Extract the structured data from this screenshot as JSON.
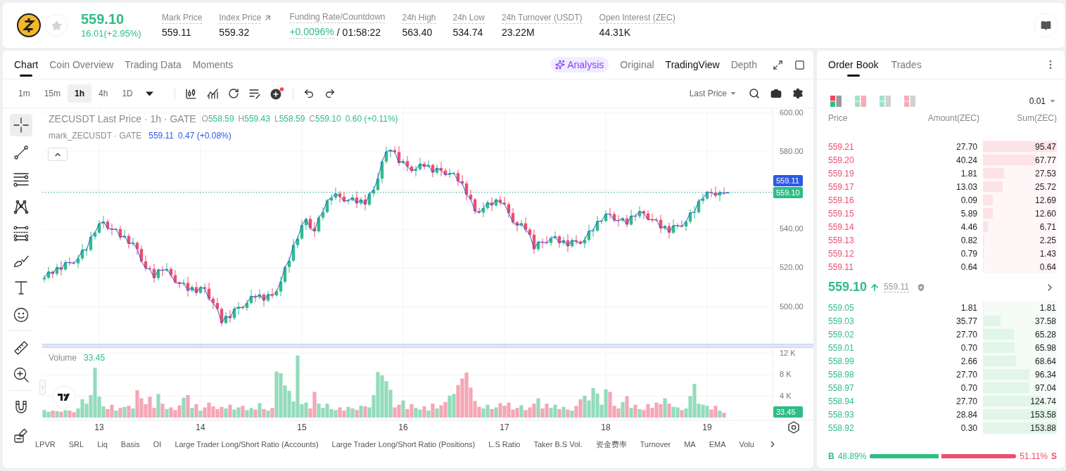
{
  "ticker": {
    "price": "559.10",
    "change": "16.01(+2.95%)",
    "stats": [
      {
        "kind": "plain",
        "label": "Mark Price",
        "value": "559.11"
      },
      {
        "kind": "link",
        "label": "Index Price",
        "value": "559.32"
      },
      {
        "kind": "funding",
        "label": "Funding Rate/Countdown",
        "value": "+0.0096%",
        "countdown": "/ 01:58:22"
      },
      {
        "kind": "plain",
        "label": "24h High",
        "value": "563.40"
      },
      {
        "kind": "plain",
        "label": "24h Low",
        "value": "534.74"
      },
      {
        "kind": "plain",
        "label": "24h Turnover (USDT)",
        "value": "23.22M"
      },
      {
        "kind": "plain",
        "label": "Open Interest (ZEC)",
        "value": "44.31K"
      }
    ]
  },
  "chart_panel": {
    "tabs": [
      {
        "label": "Chart",
        "selected": true
      },
      {
        "label": "Coin Overview",
        "selected": false
      },
      {
        "label": "Trading Data",
        "selected": false
      },
      {
        "label": "Moments",
        "selected": false
      }
    ],
    "ai_button": {
      "label": "Analysis"
    },
    "views": [
      {
        "label": "Original",
        "selected": false
      },
      {
        "label": "TradingView",
        "selected": true
      },
      {
        "label": "Depth",
        "selected": false
      }
    ],
    "intervals": [
      {
        "label": "1m",
        "selected": false
      },
      {
        "label": "15m",
        "selected": false
      },
      {
        "label": "1h",
        "selected": true
      },
      {
        "label": "4h",
        "selected": false
      },
      {
        "label": "1D",
        "selected": false
      }
    ],
    "price_source": "Last Price",
    "tool_groups": [
      [
        {
          "kind": "crosshair",
          "selected": true
        },
        {
          "kind": "trend_line",
          "selected": false
        },
        {
          "kind": "horizontal_lines",
          "selected": false
        },
        {
          "kind": "pattern",
          "selected": false
        },
        {
          "kind": "fib",
          "selected": false
        },
        {
          "kind": "brush",
          "selected": false
        },
        {
          "kind": "text",
          "selected": false
        },
        {
          "kind": "emoji",
          "selected": false
        }
      ],
      [
        {
          "kind": "ruler",
          "selected": false
        },
        {
          "kind": "zoom",
          "selected": false
        }
      ],
      [
        {
          "kind": "magnet",
          "selected": false
        },
        {
          "kind": "lock_drawing",
          "selected": false
        }
      ]
    ],
    "price_pane": {
      "legend": {
        "ohlc": [
          {
            "key": "O",
            "value": "558.59"
          },
          {
            "key": "H",
            "value": "559.43"
          },
          {
            "key": "L",
            "value": "558.59"
          },
          {
            "key": "C",
            "value": "559.10"
          }
        ],
        "change": "0.60 (+0.11%)",
        "mark_price": "559.11",
        "mark_change": "0.47 (+0.08%)"
      },
      "mark_badge": "559.11",
      "last_badge": "559.10",
      "chart_data": {
        "type": "candlestick",
        "title": "ZECUSDT Last Price · 1h · GATE",
        "grid": true,
        "ylim": [
          481,
          602.5
        ],
        "yticks": [
          {
            "value": 600,
            "label": "600.00"
          },
          {
            "value": 580,
            "label": "580.00"
          },
          {
            "value": 540,
            "label": "540.00"
          },
          {
            "value": 520,
            "label": "520.00"
          },
          {
            "value": 500,
            "label": "500.00"
          }
        ],
        "ref_lines": [
          {
            "axis": "y",
            "value": 559.1
          }
        ],
        "categories": [
          null,
          null,
          null,
          null,
          null,
          null,
          null,
          null,
          null,
          null,
          null,
          null,
          null,
          null,
          null,
          null,
          null,
          null,
          null,
          null,
          null,
          null,
          null,
          null,
          null,
          null,
          null,
          null,
          null,
          null,
          null,
          null,
          null,
          null,
          null,
          null,
          null,
          null,
          null,
          null,
          null,
          null,
          null,
          null,
          null,
          null,
          null,
          null,
          null,
          null,
          null,
          null,
          null,
          null,
          null,
          null,
          null,
          null,
          null,
          null,
          null,
          null,
          null,
          null,
          null,
          null,
          null,
          null,
          null,
          null,
          null,
          null,
          null,
          null,
          null,
          null,
          null,
          null,
          null,
          null,
          null,
          null,
          null,
          null,
          null,
          null,
          null,
          null,
          null,
          null,
          null,
          null,
          null,
          null,
          null,
          null,
          null,
          null,
          null,
          null,
          null,
          null,
          null,
          null,
          null,
          null,
          null,
          null,
          null,
          null,
          null,
          null,
          null,
          null,
          null,
          null,
          null,
          null,
          null,
          null,
          null,
          null,
          null,
          null,
          null,
          null,
          null,
          null,
          null,
          null,
          null,
          null,
          null,
          null,
          null,
          null,
          null,
          null,
          null,
          null,
          null,
          null,
          null,
          null,
          null,
          null,
          null,
          null,
          null,
          null,
          null,
          null,
          null,
          null,
          null,
          null,
          null,
          null,
          null,
          null,
          null,
          null,
          null,
          null,
          null,
          null,
          null,
          null,
          null,
          null,
          null,
          null,
          null
        ],
        "ohlc": [
          [
            514.2,
            516.2,
            512.7,
            515.0
          ],
          [
            515.0,
            520.8,
            514.4,
            518.2
          ],
          [
            518.2,
            518.9,
            514.7,
            517.1
          ],
          [
            517.1,
            522.3,
            516.0,
            520.5
          ],
          [
            520.5,
            523.6,
            516.3,
            519.3
          ],
          [
            519.3,
            524.2,
            518.5,
            523.0
          ],
          [
            523.0,
            525.6,
            521.4,
            522.9
          ],
          [
            522.9,
            523.6,
            521.9,
            522.5
          ],
          [
            522.5,
            526.8,
            520.1,
            525.0
          ],
          [
            525.0,
            532.5,
            523.9,
            529.4
          ],
          [
            529.4,
            530.6,
            526.4,
            529.4
          ],
          [
            529.4,
            538.8,
            528.6,
            536.2
          ],
          [
            536.2,
            539.0,
            534.7,
            538.3
          ],
          [
            538.3,
            544.8,
            537.7,
            543.0
          ],
          [
            543.0,
            547.1,
            540.6,
            544.0
          ],
          [
            544.0,
            545.2,
            539.4,
            540.5
          ],
          [
            540.5,
            543.1,
            537.0,
            540.0
          ],
          [
            540.0,
            540.8,
            539.2,
            540.1
          ],
          [
            540.1,
            541.9,
            534.4,
            535.9
          ],
          [
            535.9,
            539.7,
            535.3,
            536.6
          ],
          [
            536.6,
            537.8,
            530.2,
            532.6
          ],
          [
            532.6,
            535.7,
            531.5,
            533.1
          ],
          [
            533.1,
            533.8,
            526.9,
            529.9
          ],
          [
            529.9,
            531.7,
            522.7,
            523.5
          ],
          [
            523.5,
            526.6,
            518.5,
            520.0
          ],
          [
            520.0,
            521.2,
            519.0,
            519.6
          ],
          [
            519.6,
            522.2,
            512.5,
            514.9
          ],
          [
            514.9,
            519.9,
            513.8,
            519.2
          ],
          [
            519.2,
            521.0,
            515.8,
            518.8
          ],
          [
            518.8,
            522.6,
            518.0,
            519.5
          ],
          [
            519.5,
            520.7,
            514.9,
            516.4
          ],
          [
            516.4,
            519.0,
            512.1,
            512.7
          ],
          [
            512.7,
            513.4,
            509.6,
            512.0
          ],
          [
            512.0,
            514.2,
            510.9,
            512.4
          ],
          [
            512.4,
            515.5,
            505.4,
            508.4
          ],
          [
            508.4,
            511.4,
            507.6,
            510.2
          ],
          [
            510.2,
            512.8,
            505.8,
            507.3
          ],
          [
            507.3,
            510.9,
            506.7,
            510.2
          ],
          [
            510.2,
            512.0,
            507.0,
            509.4
          ],
          [
            509.4,
            512.5,
            503.1,
            504.2
          ],
          [
            504.2,
            505.4,
            499.0,
            502.0
          ],
          [
            502.0,
            504.6,
            498.2,
            499.0
          ],
          [
            499.0,
            499.7,
            490.2,
            491.7
          ],
          [
            491.7,
            497.1,
            491.1,
            495.3
          ],
          [
            495.3,
            498.4,
            491.9,
            494.3
          ],
          [
            494.3,
            500.2,
            493.2,
            499.0
          ],
          [
            499.0,
            502.5,
            496.0,
            499.9
          ],
          [
            499.9,
            500.6,
            498.7,
            499.5
          ],
          [
            499.5,
            503.8,
            498.0,
            502.0
          ],
          [
            502.0,
            508.7,
            501.4,
            505.6
          ],
          [
            505.6,
            506.8,
            502.5,
            504.9
          ],
          [
            504.9,
            509.0,
            503.8,
            506.4
          ],
          [
            506.4,
            507.1,
            500.3,
            503.3
          ],
          [
            503.3,
            508.3,
            502.5,
            506.5
          ],
          [
            506.5,
            509.6,
            504.4,
            505.9
          ],
          [
            505.9,
            509.2,
            505.3,
            508.0
          ],
          [
            508.0,
            515.6,
            505.6,
            513.0
          ],
          [
            513.0,
            521.3,
            511.9,
            520.6
          ],
          [
            520.6,
            525.7,
            517.6,
            523.9
          ],
          [
            523.9,
            535.0,
            523.1,
            531.9
          ],
          [
            531.9,
            536.5,
            530.4,
            535.3
          ],
          [
            535.3,
            544.8,
            534.7,
            542.2
          ],
          [
            542.2,
            546.1,
            539.8,
            545.4
          ],
          [
            545.4,
            547.2,
            539.6,
            540.7
          ],
          [
            540.7,
            543.8,
            536.0,
            539.0
          ],
          [
            539.0,
            547.3,
            538.2,
            546.1
          ],
          [
            546.1,
            551.5,
            544.6,
            548.9
          ],
          [
            548.9,
            555.6,
            548.3,
            554.9
          ],
          [
            554.9,
            558.1,
            552.5,
            556.3
          ],
          [
            556.3,
            561.6,
            555.2,
            558.5
          ],
          [
            558.5,
            559.7,
            553.9,
            556.9
          ],
          [
            556.9,
            559.5,
            553.7,
            554.5
          ],
          [
            554.5,
            555.7,
            553.0,
            555.0
          ],
          [
            555.0,
            558.2,
            554.4,
            556.4
          ],
          [
            556.4,
            559.5,
            551.0,
            553.4
          ],
          [
            553.4,
            556.6,
            552.3,
            555.4
          ],
          [
            555.4,
            558.0,
            549.8,
            552.8
          ],
          [
            552.8,
            559.2,
            552.0,
            558.5
          ],
          [
            558.5,
            562.2,
            557.0,
            560.4
          ],
          [
            560.4,
            569.3,
            559.8,
            566.2
          ],
          [
            566.2,
            576.2,
            563.8,
            575.0
          ],
          [
            575.0,
            582.7,
            573.9,
            580.1
          ],
          [
            580.1,
            581.6,
            577.1,
            580.9
          ],
          [
            580.9,
            582.7,
            579.1,
            579.9
          ],
          [
            579.9,
            583.0,
            572.8,
            574.3
          ],
          [
            574.3,
            576.4,
            573.7,
            575.2
          ],
          [
            575.2,
            577.8,
            570.0,
            572.4
          ],
          [
            572.4,
            573.1,
            569.1,
            570.2
          ],
          [
            570.2,
            572.8,
            567.2,
            571.0
          ],
          [
            571.0,
            577.0,
            570.2,
            573.9
          ],
          [
            573.9,
            575.1,
            570.9,
            572.4
          ],
          [
            572.4,
            575.8,
            571.8,
            573.2
          ],
          [
            573.2,
            573.9,
            566.9,
            569.3
          ],
          [
            569.3,
            573.5,
            568.2,
            571.7
          ],
          [
            571.7,
            574.8,
            567.4,
            570.4
          ],
          [
            570.4,
            571.6,
            567.3,
            568.1
          ],
          [
            568.1,
            571.4,
            566.6,
            568.8
          ],
          [
            568.8,
            569.7,
            568.2,
            569.0
          ],
          [
            569.0,
            570.8,
            562.5,
            564.9
          ],
          [
            564.9,
            568.0,
            562.6,
            563.7
          ],
          [
            563.7,
            564.9,
            554.9,
            557.9
          ],
          [
            557.9,
            560.5,
            554.7,
            555.5
          ],
          [
            555.5,
            556.2,
            547.9,
            549.4
          ],
          [
            549.4,
            551.2,
            548.1,
            548.7
          ],
          [
            548.7,
            554.1,
            546.3,
            551.0
          ],
          [
            551.0,
            555.1,
            549.9,
            553.9
          ],
          [
            553.9,
            556.5,
            549.4,
            552.4
          ],
          [
            552.4,
            556.1,
            551.6,
            555.4
          ],
          [
            555.4,
            557.2,
            552.3,
            553.8
          ],
          [
            553.8,
            556.9,
            552.4,
            553.0
          ],
          [
            553.0,
            554.2,
            546.0,
            548.4
          ],
          [
            548.4,
            551.0,
            542.6,
            543.7
          ],
          [
            543.7,
            544.4,
            539.0,
            542.0
          ],
          [
            542.0,
            544.9,
            541.2,
            543.1
          ],
          [
            543.1,
            546.2,
            538.4,
            539.9
          ],
          [
            539.9,
            541.1,
            536.6,
            537.2
          ],
          [
            537.2,
            539.8,
            527.4,
            529.8
          ],
          [
            529.8,
            534.2,
            528.7,
            533.5
          ],
          [
            533.5,
            535.3,
            530.4,
            533.4
          ],
          [
            533.4,
            536.5,
            532.2,
            533.0
          ],
          [
            533.0,
            536.7,
            531.5,
            535.5
          ],
          [
            535.5,
            539.0,
            534.9,
            536.4
          ],
          [
            536.4,
            537.1,
            530.5,
            532.9
          ],
          [
            532.9,
            536.2,
            531.8,
            534.4
          ],
          [
            534.4,
            537.5,
            528.3,
            531.3
          ],
          [
            531.3,
            535.6,
            530.5,
            534.4
          ],
          [
            534.4,
            537.0,
            532.2,
            533.7
          ],
          [
            533.7,
            534.4,
            532.1,
            532.7
          ],
          [
            532.7,
            536.4,
            530.3,
            534.6
          ],
          [
            534.6,
            542.3,
            533.5,
            539.2
          ],
          [
            539.2,
            540.6,
            536.2,
            539.4
          ],
          [
            539.4,
            546.8,
            538.6,
            544.2
          ],
          [
            544.2,
            545.0,
            542.7,
            544.3
          ],
          [
            544.3,
            549.8,
            543.7,
            548.0
          ],
          [
            548.0,
            551.1,
            545.5,
            547.9
          ],
          [
            547.9,
            549.1,
            543.6,
            544.7
          ],
          [
            544.7,
            547.3,
            541.5,
            544.5
          ],
          [
            544.5,
            546.4,
            543.7,
            545.7
          ],
          [
            545.7,
            547.5,
            541.0,
            542.5
          ],
          [
            542.5,
            550.1,
            541.9,
            547.0
          ],
          [
            547.0,
            548.2,
            544.4,
            546.8
          ],
          [
            546.8,
            552.0,
            545.7,
            549.4
          ],
          [
            549.4,
            550.1,
            545.2,
            548.2
          ],
          [
            548.2,
            550.0,
            544.3,
            545.1
          ],
          [
            545.1,
            548.2,
            543.5,
            545.0
          ],
          [
            545.0,
            546.2,
            544.3,
            544.9
          ],
          [
            544.9,
            547.5,
            538.1,
            540.5
          ],
          [
            540.5,
            542.4,
            539.4,
            541.7
          ],
          [
            541.7,
            543.5,
            535.3,
            538.3
          ],
          [
            538.3,
            545.1,
            537.5,
            542.0
          ],
          [
            542.0,
            543.2,
            540.5,
            542.0
          ],
          [
            542.0,
            544.6,
            540.9,
            541.5
          ],
          [
            541.5,
            544.7,
            539.1,
            544.0
          ],
          [
            544.0,
            550.4,
            542.9,
            548.6
          ],
          [
            548.6,
            552.0,
            545.6,
            548.9
          ],
          [
            548.9,
            555.9,
            548.1,
            554.7
          ],
          [
            554.7,
            558.5,
            553.2,
            555.9
          ],
          [
            555.9,
            560.0,
            555.3,
            559.3
          ],
          [
            559.3,
            561.1,
            556.6,
            559.0
          ],
          [
            559.0,
            562.1,
            556.4,
            557.5
          ],
          [
            557.5,
            560.2,
            554.5,
            559.0
          ],
          [
            559.0,
            561.6,
            557.8,
            558.6
          ],
          [
            558.6,
            559.4,
            558.6,
            559.1
          ],
          null,
          null,
          null,
          null,
          null,
          null,
          null,
          null,
          null,
          null
        ],
        "series": [
          {
            "name": "mark_ZECUSDT · GATE",
            "type": "line",
            "color": "#2d5be3",
            "values": [
              515.0,
              518.2,
              517.1,
              520.5,
              519.3,
              523.0,
              522.9,
              522.5,
              525.0,
              529.4,
              529.4,
              536.2,
              538.3,
              543.0,
              544.0,
              540.5,
              540.0,
              540.1,
              535.9,
              536.6,
              532.6,
              533.1,
              529.9,
              523.5,
              520.0,
              519.6,
              514.9,
              519.2,
              518.8,
              519.5,
              516.4,
              512.7,
              512.0,
              512.4,
              508.4,
              510.2,
              507.3,
              510.2,
              509.4,
              504.2,
              502.0,
              499.0,
              491.7,
              495.3,
              494.3,
              499.0,
              499.9,
              499.5,
              502.0,
              505.6,
              504.9,
              506.4,
              503.3,
              506.5,
              505.9,
              508.0,
              513.0,
              520.6,
              523.9,
              531.9,
              535.3,
              542.2,
              545.4,
              540.7,
              539.0,
              546.1,
              548.9,
              554.9,
              556.3,
              558.5,
              556.9,
              554.5,
              555.0,
              556.4,
              553.4,
              555.4,
              552.8,
              558.5,
              560.4,
              566.2,
              575.0,
              580.1,
              580.9,
              579.9,
              574.3,
              575.2,
              572.4,
              570.2,
              571.0,
              573.9,
              572.4,
              573.2,
              569.3,
              571.7,
              570.4,
              568.1,
              568.8,
              569.0,
              564.9,
              563.7,
              557.9,
              555.5,
              549.4,
              548.7,
              551.0,
              553.9,
              552.4,
              555.4,
              553.8,
              553.0,
              548.4,
              543.7,
              542.0,
              543.1,
              539.9,
              537.2,
              529.8,
              533.5,
              533.4,
              533.0,
              535.5,
              536.4,
              532.9,
              534.4,
              531.3,
              534.4,
              533.7,
              532.7,
              534.6,
              539.2,
              539.4,
              544.2,
              544.3,
              548.0,
              547.9,
              544.7,
              544.5,
              545.7,
              542.5,
              547.0,
              546.8,
              549.4,
              548.2,
              545.1,
              545.0,
              544.9,
              540.5,
              541.7,
              538.3,
              542.0,
              542.0,
              541.5,
              544.0,
              548.6,
              548.9,
              554.7,
              555.9,
              559.3,
              559.0,
              557.5,
              559.0,
              558.6,
              559.1,
              null,
              null,
              null,
              null,
              null,
              null,
              null,
              null,
              null,
              null
            ]
          }
        ]
      }
    },
    "volume_pane": {
      "value": "33.45",
      "badge": "33.45",
      "chart_data": {
        "type": "bar",
        "grid": true,
        "ylim": [
          0,
          13
        ],
        "yticks": [
          {
            "value": 12,
            "label": "12 K"
          },
          {
            "value": 8,
            "label": "8 K"
          },
          {
            "value": 4,
            "label": "4 K"
          }
        ],
        "categories": [
          null,
          null,
          null,
          null,
          null,
          null,
          null,
          null,
          null,
          null,
          null,
          null,
          null,
          "13",
          null,
          null,
          null,
          null,
          null,
          null,
          null,
          null,
          null,
          null,
          null,
          null,
          null,
          null,
          null,
          null,
          null,
          null,
          null,
          null,
          null,
          null,
          null,
          "14",
          null,
          null,
          null,
          null,
          null,
          null,
          null,
          null,
          null,
          null,
          null,
          null,
          null,
          null,
          null,
          null,
          null,
          null,
          null,
          null,
          null,
          null,
          null,
          "15",
          null,
          null,
          null,
          null,
          null,
          null,
          null,
          null,
          null,
          null,
          null,
          null,
          null,
          null,
          null,
          null,
          null,
          null,
          null,
          null,
          null,
          null,
          null,
          "16",
          null,
          null,
          null,
          null,
          null,
          null,
          null,
          null,
          null,
          null,
          null,
          null,
          null,
          null,
          null,
          null,
          null,
          null,
          null,
          null,
          null,
          null,
          null,
          "17",
          null,
          null,
          null,
          null,
          null,
          null,
          null,
          null,
          null,
          null,
          null,
          null,
          null,
          null,
          null,
          null,
          null,
          null,
          null,
          null,
          null,
          null,
          null,
          "18",
          null,
          null,
          null,
          null,
          null,
          null,
          null,
          null,
          null,
          null,
          null,
          null,
          null,
          null,
          null,
          null,
          null,
          null,
          null,
          null,
          null,
          null,
          null,
          "19",
          null,
          null,
          null,
          null,
          null,
          null,
          null,
          null,
          null,
          null,
          null,
          null,
          null,
          null,
          null
        ],
        "series": [
          {
            "name": "Volume",
            "values": [
              1.4,
              1.1,
              1.3,
              1.2,
              1.1,
              1.4,
              1.3,
              1.0,
              1.7,
              3.4,
              2.6,
              4.2,
              9.3,
              3.9,
              2.1,
              1.6,
              2.4,
              1.3,
              1.8,
              2.0,
              2.2,
              1.7,
              5.1,
              3.6,
              2.5,
              3.9,
              1.8,
              4.4,
              2.6,
              1.6,
              1.9,
              1.4,
              2.3,
              3.7,
              4.2,
              1.8,
              2.5,
              1.3,
              1.9,
              2.8,
              2.1,
              1.6,
              2.0,
              1.7,
              2.4,
              1.5,
              1.9,
              2.2,
              1.4,
              1.8,
              1.5,
              2.7,
              1.6,
              1.3,
              1.8,
              8.6,
              8.3,
              6.0,
              5.0,
              3.0,
              11.6,
              2.5,
              2.8,
              1.7,
              4.8,
              2.6,
              1.8,
              2.6,
              1.6,
              1.4,
              1.9,
              1.3,
              2.0,
              1.7,
              1.4,
              2.2,
              2.1,
              1.9,
              4.2,
              8.5,
              7.9,
              6.8,
              5.2,
              1.9,
              2.4,
              3.2,
              1.6,
              2.5,
              1.8,
              1.5,
              2.1,
              1.3,
              2.6,
              1.7,
              2.3,
              2.9,
              4.1,
              4.4,
              6.1,
              7.3,
              8.4,
              5.6,
              3.1,
              2.0,
              1.7,
              2.4,
              1.6,
              1.9,
              2.7,
              2.2,
              2.8,
              1.5,
              1.8,
              2.3,
              1.4,
              1.9,
              2.6,
              3.6,
              1.7,
              2.6,
              1.8,
              2.4,
              1.6,
              2.0,
              1.5,
              1.3,
              2.2,
              3.4,
              4.1,
              3.2,
              5.5,
              4.5,
              2.4,
              5.3,
              4.8,
              2.2,
              1.7,
              2.9,
              4.0,
              1.8,
              2.4,
              1.6,
              1.4,
              2.5,
              1.8,
              2.8,
              2.5,
              3.6,
              2.6,
              2.0,
              1.9,
              1.4,
              1.7,
              4.0,
              6.3,
              2.6,
              2.4,
              2.2,
              1.5,
              2.2,
              1.3,
              0.9,
              0,
              null,
              null,
              null,
              null,
              null,
              null,
              null,
              null,
              null,
              null
            ]
          }
        ]
      }
    },
    "indicators": [
      "LPVR",
      "SRL",
      "Liq",
      "Basis",
      "OI",
      "Large Trader Long/Short Ratio (Accounts)",
      "Large Trader Long/Short Ratio (Positions)",
      "L.S Ratio",
      "Taker B.S Vol.",
      "资金费率",
      "Turnover",
      "MA",
      "EMA",
      "Volu"
    ]
  },
  "order_book": {
    "tabs": [
      {
        "label": "Order Book",
        "selected": true
      },
      {
        "label": "Trades",
        "selected": false
      }
    ],
    "layouts": [
      {
        "kind": "split",
        "selected": true
      },
      {
        "kind": "both",
        "selected": false
      },
      {
        "kind": "bids",
        "selected": false
      },
      {
        "kind": "asks",
        "selected": false
      }
    ],
    "precision": "0.01",
    "columns": [
      "Price",
      "Amount(ZEC)",
      "Sum(ZEC)"
    ],
    "asks": [
      {
        "price": "559.21",
        "amount": "27.70",
        "sum": "95.47",
        "level": 1
      },
      {
        "price": "559.20",
        "amount": "40.24",
        "sum": "67.77",
        "level": 0.71
      },
      {
        "price": "559.19",
        "amount": "1.81",
        "sum": "27.53",
        "level": 0.29
      },
      {
        "price": "559.17",
        "amount": "13.03",
        "sum": "25.72",
        "level": 0.27
      },
      {
        "price": "559.16",
        "amount": "0.09",
        "sum": "12.69",
        "level": 0.13
      },
      {
        "price": "559.15",
        "amount": "5.89",
        "sum": "12.60",
        "level": 0.13
      },
      {
        "price": "559.14",
        "amount": "4.46",
        "sum": "6.71",
        "level": 0.07
      },
      {
        "price": "559.13",
        "amount": "0.82",
        "sum": "2.25",
        "level": 0.02
      },
      {
        "price": "559.12",
        "amount": "0.79",
        "sum": "1.43",
        "level": 0.01
      },
      {
        "price": "559.11",
        "amount": "0.64",
        "sum": "0.64",
        "level": 0.01
      }
    ],
    "last": {
      "price": "559.10",
      "mark": "559.11"
    },
    "bids": [
      {
        "price": "559.05",
        "amount": "1.81",
        "sum": "1.81",
        "level": 0.01
      },
      {
        "price": "559.03",
        "amount": "35.77",
        "sum": "37.58",
        "level": 0.24
      },
      {
        "price": "559.02",
        "amount": "27.70",
        "sum": "65.28",
        "level": 0.42
      },
      {
        "price": "559.01",
        "amount": "0.70",
        "sum": "65.98",
        "level": 0.43
      },
      {
        "price": "558.99",
        "amount": "2.66",
        "sum": "68.64",
        "level": 0.45
      },
      {
        "price": "558.98",
        "amount": "27.70",
        "sum": "96.34",
        "level": 0.63
      },
      {
        "price": "558.97",
        "amount": "0.70",
        "sum": "97.04",
        "level": 0.63
      },
      {
        "price": "558.94",
        "amount": "27.70",
        "sum": "124.74",
        "level": 0.81
      },
      {
        "price": "558.93",
        "amount": "28.84",
        "sum": "153.58",
        "level": 1
      },
      {
        "price": "558.92",
        "amount": "0.30",
        "sum": "153.88",
        "level": 1
      }
    ],
    "ratio": {
      "buy_label": "B",
      "buy": "48.89%",
      "sell": "51.11%",
      "sell_label": "S",
      "level": 0.4889
    }
  }
}
